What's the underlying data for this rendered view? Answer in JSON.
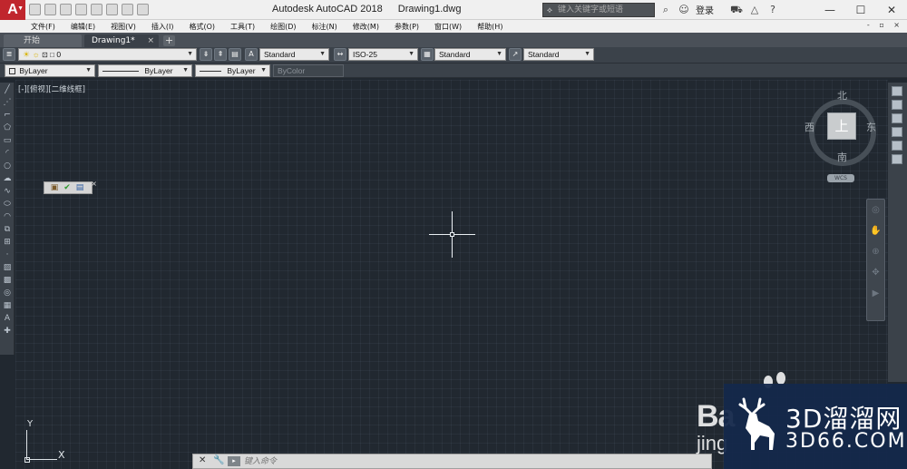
{
  "titlebar": {
    "app_letter": "A",
    "app_name": "Autodesk AutoCAD 2018",
    "doc_name": "Drawing1.dwg",
    "search_placeholder": "键入关键字或短语",
    "login_label": "登录",
    "win_min": "—",
    "win_max": "☐",
    "win_close": "✕"
  },
  "menubar": {
    "items": [
      "文件(F)",
      "编辑(E)",
      "视图(V)",
      "插入(I)",
      "格式(O)",
      "工具(T)",
      "绘图(D)",
      "标注(N)",
      "修改(M)",
      "参数(P)",
      "窗口(W)",
      "帮助(H)"
    ],
    "right_controls": "- ▫ ×"
  },
  "tabs": {
    "start_label": "开始",
    "active_label": "Drawing1*",
    "close_glyph": "×",
    "new_tab_glyph": "+"
  },
  "toolbar1": {
    "layer_value": "0",
    "text_style": "Standard",
    "dim_style": "ISO-25",
    "table_style": "Standard",
    "multileader_style": "Standard"
  },
  "toolbar2": {
    "color": "ByLayer",
    "linetype": "ByLayer",
    "lineweight": "ByLayer",
    "plotstyle": "ByColor"
  },
  "canvas": {
    "view_label": "[-][俯视][二维线框]"
  },
  "viewcube": {
    "top_face": "上",
    "north": "北",
    "south": "南",
    "east": "东",
    "west": "西",
    "wcs": "WCS"
  },
  "ucs": {
    "x_label": "X",
    "y_label": "Y"
  },
  "command_line": {
    "placeholder": "键入命令"
  },
  "watermark": {
    "baidu_main": "Ba",
    "baidu_sub": "jing",
    "site_title": "3D溜溜网",
    "site_url": "3D66.COM"
  },
  "colors": {
    "canvas": "#212830",
    "app_red": "#c0262d",
    "panel": "#3b424a"
  }
}
